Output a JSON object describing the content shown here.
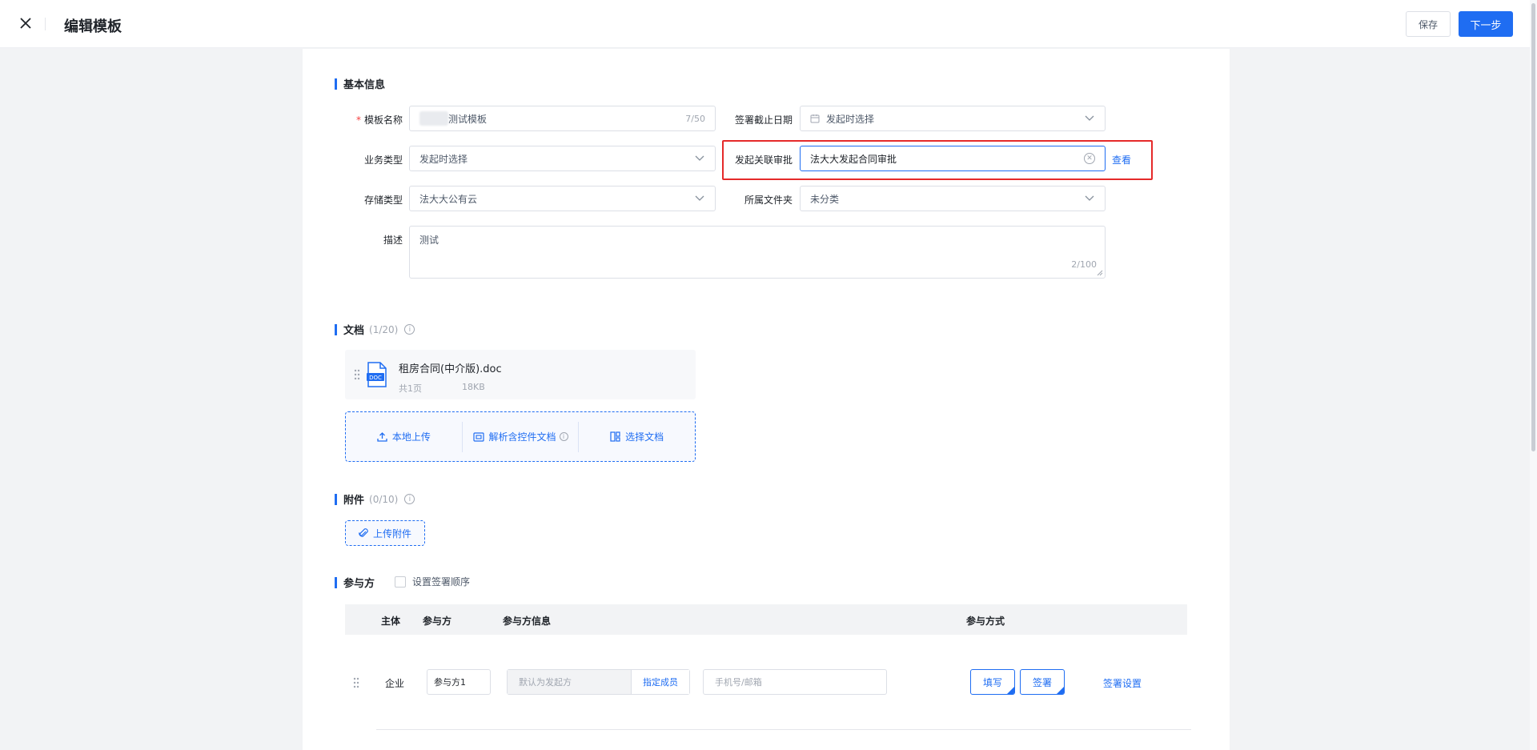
{
  "header": {
    "title": "编辑模板",
    "save_label": "保存",
    "next_label": "下一步"
  },
  "basic_info": {
    "section_title": "基本信息",
    "template_name": {
      "label": "模板名称",
      "value": "测试模板",
      "count": "7/50"
    },
    "sign_deadline": {
      "label": "签署截止日期",
      "value": "发起时选择"
    },
    "business_type": {
      "label": "业务类型",
      "value": "发起时选择"
    },
    "linked_approval": {
      "label": "发起关联审批",
      "value": "法大大发起合同审批",
      "view_link": "查看"
    },
    "storage_type": {
      "label": "存储类型",
      "value": "法大大公有云"
    },
    "folder": {
      "label": "所属文件夹",
      "value": "未分类"
    },
    "description": {
      "label": "描述",
      "value": "测试",
      "count": "2/100"
    }
  },
  "documents": {
    "section_title": "文档",
    "count": "(1/20)",
    "file": {
      "name": "租房合同(中介版).doc",
      "pages": "共1页",
      "size": "18KB",
      "icon": "doc-file-icon"
    },
    "upload_options": {
      "local": "本地上传",
      "parse": "解析含控件文档",
      "select": "选择文档"
    }
  },
  "attachments": {
    "section_title": "附件",
    "count": "(0/10)",
    "upload_label": "上传附件"
  },
  "participants": {
    "section_title": "参与方",
    "order_checkbox_label": "设置签署顺序",
    "columns": {
      "subject": "主体",
      "party": "参与方",
      "info": "参与方信息",
      "mode": "参与方式"
    },
    "rows": [
      {
        "subject": "企业",
        "party": "参与方1",
        "default_placeholder": "默认为发起方",
        "assign_label": "指定成员",
        "contact_placeholder": "手机号/邮箱",
        "fill_label": "填写",
        "sign_label": "签署",
        "settings_label": "签署设置"
      }
    ]
  },
  "colors": {
    "accent": "#1f6df2",
    "highlight": "#e52a2a",
    "required": "#f53f3f"
  }
}
